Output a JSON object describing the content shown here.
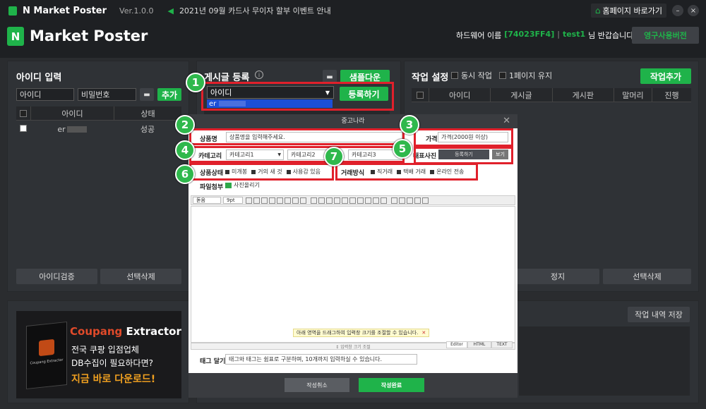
{
  "titlebar": {
    "app_name": "N Market Poster",
    "version": "Ver.1.0.0",
    "notice": "2021년 09월 카드사 무이자 할부 이벤트 안내",
    "home_btn": "홈페이지 바로가기"
  },
  "header": {
    "logo_letter": "N",
    "logo_text": "Market Poster",
    "hw_label": "하드웨어 이름",
    "hw_id": "[74023FF4]",
    "sep": "|",
    "user": "test1",
    "greet": "님 반갑습니다!",
    "license_btn": "영구사용버전"
  },
  "left": {
    "title": "아이디 입력",
    "id_placeholder": "아이디",
    "pw_placeholder": "비밀번호",
    "add_btn": "추가",
    "col_id": "아이디",
    "col_status": "상태",
    "row_id": "er",
    "row_status": "성공",
    "verify_btn": "아이디검증",
    "delete_btn": "선택삭제"
  },
  "post": {
    "title": "게시글 등록",
    "sample_btn": "샘플다운",
    "account_value": "아이디",
    "register_btn": "등록하기",
    "dropdown_item": "er"
  },
  "job": {
    "title": "작업 설정",
    "sim_label": "동시 작업",
    "page_label": "1페이지 유지",
    "add_btn": "작업추가",
    "cols": [
      "아이디",
      "게시글",
      "게시판",
      "말머리",
      "진행"
    ],
    "stop_btn": "정지",
    "delete_btn": "선택삭제",
    "save_btn": "작업 내역 저장"
  },
  "ad": {
    "brand_a": "Coupang",
    "brand_b": " Extractor",
    "line1": "전국 쿠팡 입점업체",
    "line2": "DB수집이 필요하다면?",
    "line3": "지금 바로 다운로드!",
    "box_label": "Coupang Extractor"
  },
  "dialog": {
    "title": "중고나라",
    "product_label": "상품명",
    "product_ph": "상품명을 입력해주세요.",
    "price_label": "가격",
    "price_ph": "가격(2000원 이상)",
    "category_label": "카테고리",
    "cat1": "카테고리1",
    "cat2": "카테고리2",
    "cat3": "카테고리3",
    "photo_label": "대표사진",
    "photo_btn": "등록하기",
    "view_btn": "보기",
    "condition_label": "상품상태",
    "conditions": [
      "미개봉",
      "거의 새 것",
      "사용감 있음"
    ],
    "trade_label": "거래방식",
    "trades": [
      "직거래",
      "택배 거래",
      "온라인 전송"
    ],
    "attach_label": "파일첨부",
    "attach_btn": "사진올리기",
    "font_sel": "돋움",
    "size_sel": "9pt",
    "resize_hint": "아래 영역을 드래그하여 입력창 크기를 조절할 수 있습니다.",
    "resize_label": "↕ 입력창 크기 조절",
    "tabs": [
      "Editor",
      "HTML",
      "TEXT"
    ],
    "tag_label": "태그 달기",
    "tag_ph": "태그와 태그는 쉼표로 구분하며, 10개까지 입력하실 수 있습니다.",
    "cancel_btn": "작성취소",
    "submit_btn": "작성완료"
  },
  "badges": [
    "1",
    "2",
    "3",
    "4",
    "5",
    "6",
    "7"
  ],
  "colors": {
    "accent": "#1fb34a",
    "highlight": "#e0202b",
    "dropdown": "#1d4fd6"
  }
}
